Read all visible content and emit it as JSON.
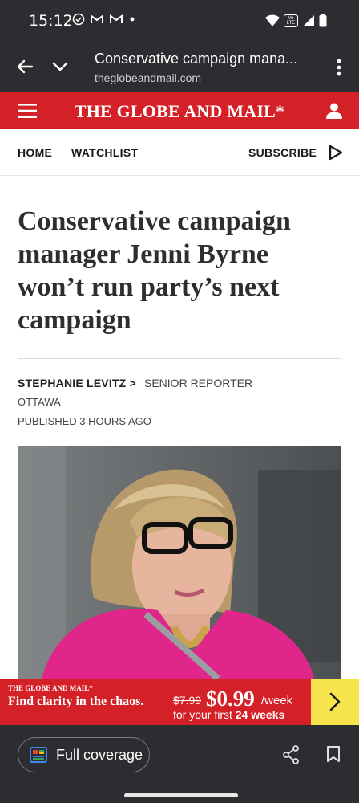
{
  "status_bar": {
    "time": "15:12",
    "left_icons": [
      "check-circle-icon",
      "gmail-icon",
      "gmail-icon",
      "dot-icon"
    ],
    "right_icons": [
      "wifi-icon",
      "volte-icon",
      "signal-icon",
      "battery-icon"
    ],
    "volte_label": "Vo LTE"
  },
  "browser": {
    "page_title": "Conservative campaign mana...",
    "domain": "theglobeandmail.com"
  },
  "site_header": {
    "masthead": "THE GLOBE AND MAIL*",
    "brand_color": "#d42027"
  },
  "nav": {
    "home": "HOME",
    "watchlist": "WATCHLIST",
    "subscribe": "SUBSCRIBE"
  },
  "article": {
    "headline": "Conservative campaign manager Jenni Byrne won’t run party’s next campaign",
    "author": "STEPHANIE LEVITZ",
    "author_chevron": ">",
    "role": "SENIOR REPORTER",
    "location": "OTTAWA",
    "published": "PUBLISHED 3 HOURS AGO"
  },
  "promo": {
    "brand": "THE GLOBE AND MAIL*",
    "text": "Find clarity in the chaos.",
    "old_price": "$7.99",
    "price": "$0.99",
    "per": "/week",
    "sub_prefix": "for your first",
    "sub_bold": "24 weeks",
    "button_color": "#f7e34c"
  },
  "bottom_bar": {
    "full_coverage": "Full coverage"
  }
}
